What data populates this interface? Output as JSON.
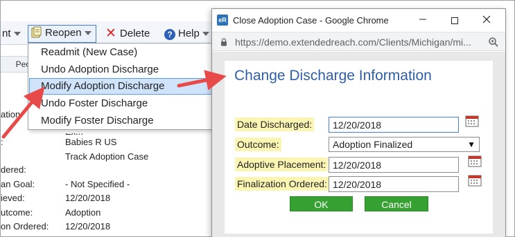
{
  "toolbar": {
    "partial_label": "nt",
    "reopen_label": "Reopen",
    "delete_label": "Delete",
    "help_label": "Help"
  },
  "tabs": {
    "peo_label": "Peo"
  },
  "details": [
    {
      "label": "ation",
      "value": "Ex..."
    },
    {
      "label": ":",
      "value": "Babies R US"
    },
    {
      "label": "",
      "value": "Track Adoption Case"
    },
    {
      "label": "dered:",
      "value": ""
    },
    {
      "label": "an Goal:",
      "value": "- Not Specified -"
    },
    {
      "label": "ieved:",
      "value": "12/20/2018"
    },
    {
      "label": "utcome:",
      "value": "Adoption"
    },
    {
      "label": "on Ordered:",
      "value": "12/20/2018"
    }
  ],
  "reopen_menu": {
    "items": [
      "Readmit (New Case)",
      "Undo Adoption Discharge",
      "Modify Adoption Discharge",
      "Undo Foster Discharge",
      "Modify Foster Discharge"
    ],
    "selected": "Modify Adoption Discharge"
  },
  "popup": {
    "window_title": "Close Adoption Case - Google Chrome",
    "app_icon_text": "eR",
    "url": "https://demo.extendedreach.com/Clients/Michigan/mi...",
    "form_title": "Change Discharge Information",
    "fields": {
      "date_discharged": {
        "label": "Date Discharged:",
        "value": "12/20/2018"
      },
      "outcome": {
        "label": "Outcome:",
        "value": "Adoption Finalized"
      },
      "adoptive_placement": {
        "label": "Adoptive Placement:",
        "value": "12/20/2018"
      },
      "finalization_ordered": {
        "label": "Finalization Ordered:",
        "value": "12/20/2018"
      }
    },
    "ok_label": "OK",
    "cancel_label": "Cancel"
  },
  "colors": {
    "accent_blue": "#2f5fa8",
    "highlight_label": "#fbf5b4",
    "button_green": "#36a032",
    "arrow_red": "#e84a4a",
    "menu_selected": "#cfe3fb"
  }
}
